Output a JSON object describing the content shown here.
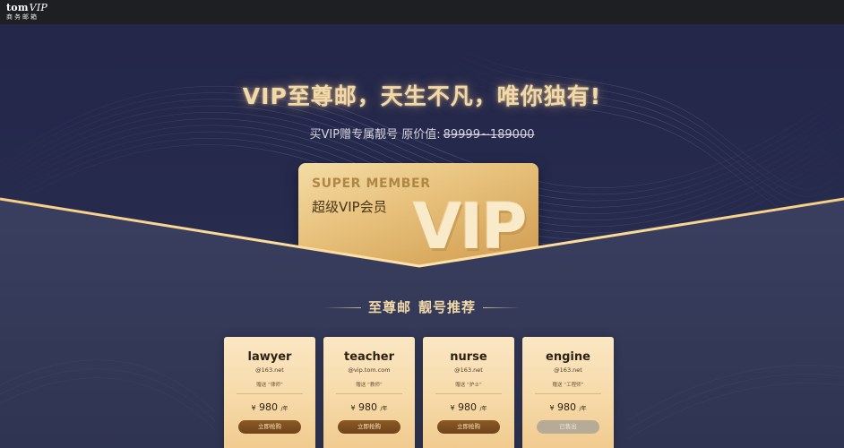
{
  "brand": {
    "logo_main": "tom",
    "logo_vip": "VIP",
    "logo_sub": "商务邮箱"
  },
  "hero": {
    "title": "VIP至尊邮，天生不凡，唯你独有!",
    "subtitle_prefix": "买VIP赠专属靓号  原价值:",
    "subtitle_price": "89999~189000"
  },
  "vip_card": {
    "tagline": "SUPER MEMBER",
    "name": "超级VIP会员",
    "watermark": "VIP"
  },
  "section": {
    "title_left": "至尊邮",
    "title_right": "靓号推荐"
  },
  "products": [
    {
      "name": "lawyer",
      "domain": "@163.net",
      "gift": "赠送 “律师”",
      "currency": "¥",
      "price": "980",
      "unit": "/年",
      "button": "立即抢购",
      "sold_out": false
    },
    {
      "name": "teacher",
      "domain": "@vip.tom.com",
      "gift": "赠送 “教师”",
      "currency": "¥",
      "price": "980",
      "unit": "/年",
      "button": "立即抢购",
      "sold_out": false
    },
    {
      "name": "nurse",
      "domain": "@163.net",
      "gift": "赠送 “护士”",
      "currency": "¥",
      "price": "980",
      "unit": "/年",
      "button": "立即抢购",
      "sold_out": false
    },
    {
      "name": "engine",
      "domain": "@163.net",
      "gift": "赠送 “工程师”",
      "currency": "¥",
      "price": "980",
      "unit": "/年",
      "button": "已售出",
      "sold_out": true
    }
  ],
  "colors": {
    "gold_text": "#f3d9a8",
    "navy_bg": "#262a4a",
    "topbar_bg": "#1e1f22",
    "button_brown": "#7a4c1f",
    "sold_gray": "#b7ab98"
  }
}
